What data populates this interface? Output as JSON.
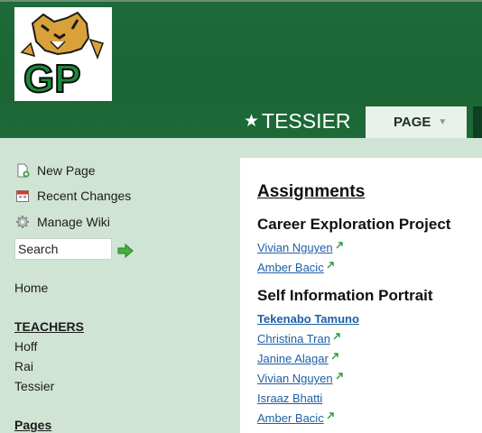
{
  "header": {
    "logo_text": "GP",
    "site_title": "TESSIER",
    "tab_page": "PAGE"
  },
  "sidebar": {
    "new_page": "New Page",
    "recent_changes": "Recent Changes",
    "manage_wiki": "Manage Wiki",
    "search_value": "Search",
    "home": "Home",
    "teachers_heading": "TEACHERS",
    "teachers": [
      "Hoff",
      "Rai",
      "Tessier"
    ],
    "pages_heading": "Pages"
  },
  "content": {
    "title": "Assignments",
    "sections": [
      {
        "heading": "Career Exploration Project",
        "links": [
          {
            "label": "Vivian Nguyen"
          },
          {
            "label": "Amber Bacic"
          }
        ]
      },
      {
        "heading": "Self Information Portrait",
        "links": [
          {
            "label": "Tekenabo Tamuno"
          },
          {
            "label": "Christina Tran"
          },
          {
            "label": "Janine Alagar"
          },
          {
            "label": "Vivian Nguyen"
          },
          {
            "label": "Israaz Bhatti"
          },
          {
            "label": "Amber Bacic"
          }
        ]
      }
    ]
  },
  "colors": {
    "header_green": "#1b6534",
    "sidebar_bg": "#cfe4d4",
    "link_blue": "#1f5fa6"
  }
}
